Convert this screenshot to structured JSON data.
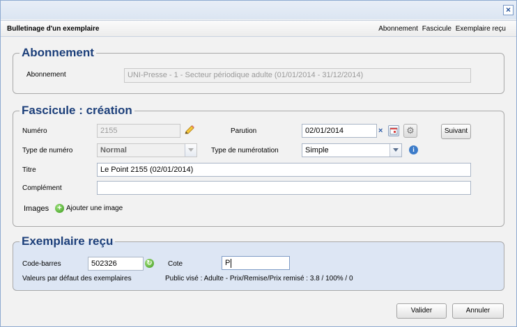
{
  "window": {
    "title": "Bulletinage d'un exemplaire",
    "close_label": "×"
  },
  "breadcrumb": [
    "Abonnement",
    "Fascicule",
    "Exemplaire reçu"
  ],
  "abonnement": {
    "legend": "Abonnement",
    "label": "Abonnement",
    "value": "UNI-Presse - 1 - Secteur périodique adulte (01/01/2014 - 31/12/2014)"
  },
  "fascicule": {
    "legend": "Fascicule : création",
    "numero_label": "Numéro",
    "numero_value": "2155",
    "parution_label": "Parution",
    "parution_value": "02/01/2014",
    "clear_label": "×",
    "suivant_label": "Suivant",
    "type_numero_label": "Type de numéro",
    "type_numero_value": "Normal",
    "type_numerotation_label": "Type de numérotation",
    "type_numerotation_value": "Simple",
    "info_label": "i",
    "titre_label": "Titre",
    "titre_value": "Le Point 2155 (02/01/2014)",
    "complement_label": "Complément",
    "complement_value": "",
    "images_label": "Images",
    "add_image_label": "Ajouter une image"
  },
  "exemplaire": {
    "legend": "Exemplaire reçu",
    "code_barres_label": "Code-barres",
    "code_barres_value": "502326",
    "cote_label": "Cote",
    "cote_value": "P",
    "defaults_label": "Valeurs par défaut des exemplaires",
    "defaults_value": "Public visé : Adulte - Prix/Remise/Prix remisé : 3.8 / 100% / 0"
  },
  "footer": {
    "valider_label": "Valider",
    "annuler_label": "Annuler"
  },
  "icons": {
    "close": "close-icon",
    "pencil": "pencil-icon",
    "calendar": "calendar-icon",
    "gear": "gear-icon",
    "info": "info-icon",
    "add": "add-icon",
    "refresh": "refresh-icon",
    "dropdown": "chevron-down-icon"
  },
  "colors": {
    "legend_blue": "#1c3f7a",
    "panel_blue": "#dde6f4",
    "info_blue": "#3d7cc9",
    "add_green": "#3a9a1c"
  }
}
